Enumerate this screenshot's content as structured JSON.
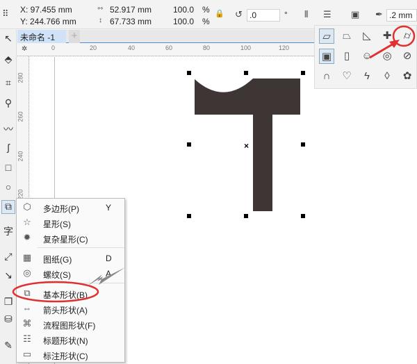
{
  "propbar": {
    "x": "X: 97.455 mm",
    "y": "Y: 244.766 mm",
    "width": "52.917 mm",
    "height": "67.733 mm",
    "scale_x": "100.0",
    "scale_y": "100.0",
    "pct": "%",
    "angle": ".0",
    "deg": "°",
    "outline": ".2 mm"
  },
  "tab": {
    "label": "未命名 -1",
    "add": "+"
  },
  "ruler": {
    "h": [
      "0",
      "20",
      "40",
      "60",
      "80",
      "100",
      "120"
    ],
    "v": [
      "280",
      "260",
      "240",
      "220"
    ]
  },
  "menu": {
    "items": [
      {
        "icon": "polygon-icon",
        "glyph": "⬡",
        "label": "多边形(P)",
        "key": "Y"
      },
      {
        "icon": "star-icon",
        "glyph": "☆",
        "label": "星形(S)",
        "key": ""
      },
      {
        "icon": "complex-star-icon",
        "glyph": "✹",
        "label": "复杂星形(C)",
        "key": ""
      },
      {
        "icon": "graph-paper-icon",
        "glyph": "▦",
        "label": "图纸(G)",
        "key": "D"
      },
      {
        "icon": "spiral-icon",
        "glyph": "◎",
        "label": "螺纹(S)",
        "key": "A"
      },
      {
        "icon": "basic-shapes-icon",
        "glyph": "⧉",
        "label": "基本形状(B)",
        "key": ""
      },
      {
        "icon": "arrow-shapes-icon",
        "glyph": "⇔",
        "label": "箭头形状(A)",
        "key": ""
      },
      {
        "icon": "flowchart-shapes-icon",
        "glyph": "⌘",
        "label": "流程图形状(F)",
        "key": ""
      },
      {
        "icon": "banner-shapes-icon",
        "glyph": "☷",
        "label": "标题形状(N)",
        "key": ""
      },
      {
        "icon": "callout-shapes-icon",
        "glyph": "▭",
        "label": "标注形状(C)",
        "key": ""
      }
    ]
  },
  "palette": [
    "parallelogram-icon",
    "trapezoid-icon",
    "triangle-icon",
    "cross-icon",
    "cylinder-icon",
    "frame-icon",
    "page-icon",
    "smiley-icon",
    "ring-icon",
    "no-symbol-icon",
    "arch-icon",
    "heart-icon",
    "lightning-icon",
    "droplet-icon",
    "plaque-icon"
  ],
  "palette_glyphs": [
    "▱",
    "⏢",
    "◺",
    "✚",
    "⌭",
    "▣",
    "▯",
    "☺",
    "◎",
    "⊘",
    "∩",
    "♡",
    "ϟ",
    "◊",
    "✿"
  ],
  "colors": {
    "shape": "#3d3635",
    "annotation": "#e03030",
    "arrow": "#888888",
    "accent": "#4a90d9"
  }
}
